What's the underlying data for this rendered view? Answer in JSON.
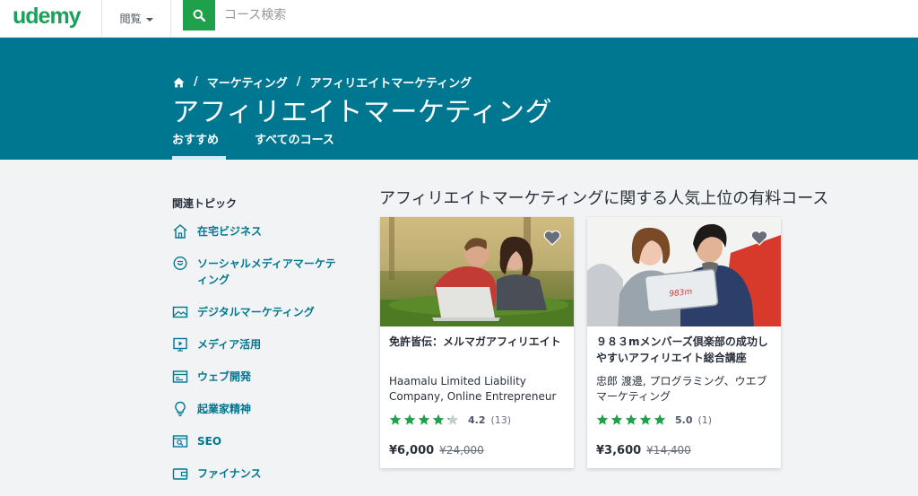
{
  "header": {
    "logo": "udemy",
    "browse_label": "閲覧",
    "search_placeholder": "コース検索"
  },
  "hero": {
    "breadcrumb": [
      "マーケティング",
      "アフィリエイトマーケティング"
    ],
    "title": "アフィリエイトマーケティング",
    "tabs": [
      {
        "label": "おすすめ",
        "active": true
      },
      {
        "label": "すべてのコース",
        "active": false
      }
    ]
  },
  "sidebar": {
    "heading": "関連トピック",
    "topics": [
      {
        "label": "在宅ビジネス",
        "icon": "home-icon"
      },
      {
        "label": "ソーシャルメディアマーケティング",
        "icon": "chat-icon"
      },
      {
        "label": "デジタルマーケティング",
        "icon": "image-icon"
      },
      {
        "label": "メディア活用",
        "icon": "video-icon"
      },
      {
        "label": "ウェブ開発",
        "icon": "browser-icon"
      },
      {
        "label": "起業家精神",
        "icon": "lightbulb-icon"
      },
      {
        "label": "SEO",
        "icon": "seo-icon"
      },
      {
        "label": "ファイナンス",
        "icon": "wallet-icon"
      }
    ]
  },
  "main": {
    "section_title": "アフィリエイトマーケティングに関する人気上位の有料コース",
    "courses": [
      {
        "title": "免許皆伝：メルマガアフィリエイト",
        "instructor": "Haamalu Limited Liability Company, Online Entrepreneur",
        "rating": 4.2,
        "rating_text": "4.2",
        "reviews": "(13)",
        "price": "¥6,000",
        "original_price": "¥24,000"
      },
      {
        "title": "９８３mメンバーズ倶楽部の成功しやすいアフィリエイト総合講座",
        "instructor": "忠郎 渡邊, プログラミング、ウエブマーケティング",
        "rating": 5.0,
        "rating_text": "5.0",
        "reviews": "(1)",
        "price": "¥3,600",
        "original_price": "¥14,400",
        "tablet_text": "983m"
      }
    ]
  },
  "colors": {
    "brand_green": "#1aa05a",
    "hero_blue": "#007791",
    "star_green": "#1fa14b",
    "link_blue": "#007791"
  }
}
